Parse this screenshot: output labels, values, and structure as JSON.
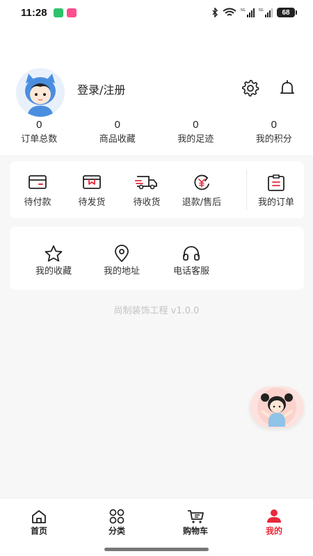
{
  "status_bar": {
    "time": "11:28",
    "battery": "68"
  },
  "profile": {
    "login_label": "登录/注册",
    "stats": [
      {
        "value": "0",
        "label": "订单总数"
      },
      {
        "value": "0",
        "label": "商品收藏"
      },
      {
        "value": "0",
        "label": "我的足迹"
      },
      {
        "value": "0",
        "label": "我的积分"
      }
    ]
  },
  "orders": {
    "items": [
      {
        "label": "待付款",
        "icon": "wallet-card-icon"
      },
      {
        "label": "待发货",
        "icon": "package-box-icon"
      },
      {
        "label": "待收货",
        "icon": "delivery-truck-icon"
      },
      {
        "label": "退款/售后",
        "icon": "refund-yen-icon"
      },
      {
        "label": "我的订单",
        "icon": "order-list-icon"
      }
    ]
  },
  "services": {
    "items": [
      {
        "label": "我的收藏",
        "icon": "star-icon"
      },
      {
        "label": "我的地址",
        "icon": "location-pin-icon"
      },
      {
        "label": "电话客服",
        "icon": "headset-icon"
      }
    ]
  },
  "version_text": "尚制装饰工程 v1.0.0",
  "tabbar": {
    "tabs": [
      {
        "label": "首页",
        "icon": "home-icon"
      },
      {
        "label": "分类",
        "icon": "category-grid-icon"
      },
      {
        "label": "购物车",
        "icon": "cart-icon"
      },
      {
        "label": "我的",
        "icon": "user-icon"
      }
    ],
    "active_index": 3
  },
  "colors": {
    "accent": "#e8283a",
    "page_background": "#f7f7f7",
    "version_text": "#c3c3c3"
  }
}
